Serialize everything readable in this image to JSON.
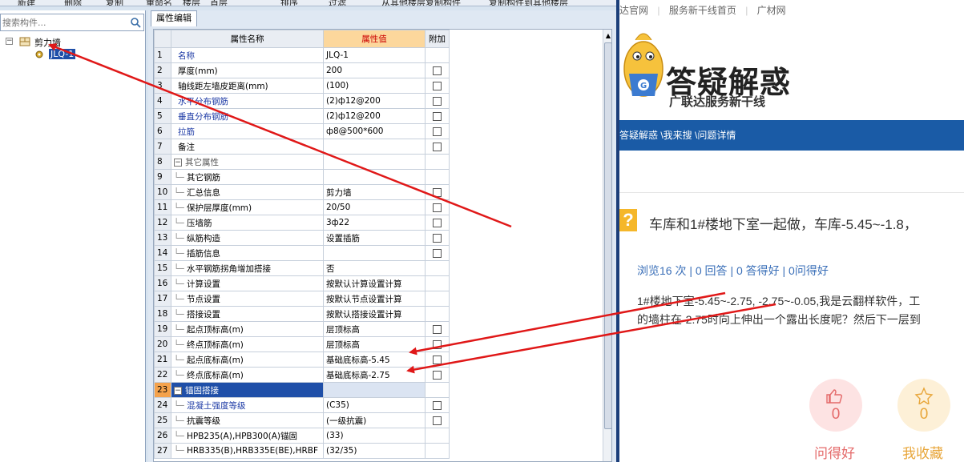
{
  "toolbar": {
    "items": [
      "新建",
      "删除",
      "复制",
      "重命名",
      "楼层",
      "首层",
      "排序",
      "过滤",
      "从其他楼层复制构件",
      "复制构件到其他楼层"
    ]
  },
  "tree": {
    "search_placeholder": "搜索构件...",
    "root": "剪力墙",
    "child": "JLQ-1"
  },
  "property_panel": {
    "tab": "属性编辑",
    "headers": {
      "name": "属性名称",
      "value": "属性值",
      "extra": "附加"
    },
    "rows": [
      {
        "num": "1",
        "name": "名称",
        "value": "JLQ-1",
        "check": false
      },
      {
        "num": "2",
        "name": "厚度(mm)",
        "value": "200",
        "check": true
      },
      {
        "num": "3",
        "name": "轴线距左墙皮距离(mm)",
        "value": "(100)",
        "check": true
      },
      {
        "num": "4",
        "name": "水平分布钢筋",
        "value": "(2)ф12@200",
        "check": true
      },
      {
        "num": "5",
        "name": "垂直分布钢筋",
        "value": "(2)ф12@200",
        "check": true
      },
      {
        "num": "6",
        "name": "拉筋",
        "value": "ф8@500*600",
        "check": true
      },
      {
        "num": "7",
        "name": "备注",
        "value": "",
        "check": true
      },
      {
        "num": "8",
        "name": "其它属性",
        "value": "",
        "check": false
      },
      {
        "num": "9",
        "name": "其它钢筋",
        "value": "",
        "check": false
      },
      {
        "num": "10",
        "name": "汇总信息",
        "value": "剪力墙",
        "check": true
      },
      {
        "num": "11",
        "name": "保护层厚度(mm)",
        "value": "20/50",
        "check": true
      },
      {
        "num": "12",
        "name": "压墙筋",
        "value": "3ф22",
        "check": true
      },
      {
        "num": "13",
        "name": "纵筋构造",
        "value": "设置插筋",
        "check": true
      },
      {
        "num": "14",
        "name": "插筋信息",
        "value": "",
        "check": true
      },
      {
        "num": "15",
        "name": "水平钢筋拐角增加搭接",
        "value": "否",
        "check": false
      },
      {
        "num": "16",
        "name": "计算设置",
        "value": "按默认计算设置计算",
        "check": false
      },
      {
        "num": "17",
        "name": "节点设置",
        "value": "按默认节点设置计算",
        "check": false
      },
      {
        "num": "18",
        "name": "搭接设置",
        "value": "按默认搭接设置计算",
        "check": false
      },
      {
        "num": "19",
        "name": "起点顶标高(m)",
        "value": "层顶标高",
        "check": true
      },
      {
        "num": "20",
        "name": "终点顶标高(m)",
        "value": "层顶标高",
        "check": true
      },
      {
        "num": "21",
        "name": "起点底标高(m)",
        "value": "基础底标高-5.45",
        "check": true
      },
      {
        "num": "22",
        "name": "终点底标高(m)",
        "value": "基础底标高-2.75",
        "check": true
      },
      {
        "num": "23",
        "name": "锚固搭接",
        "value": "",
        "check": false
      },
      {
        "num": "24",
        "name": "混凝土强度等级",
        "value": "(C35)",
        "check": true
      },
      {
        "num": "25",
        "name": "抗震等级",
        "value": "(一级抗震)",
        "check": true
      },
      {
        "num": "26",
        "name": "HPB235(A),HPB300(A)锚固",
        "value": "(33)",
        "check": false
      },
      {
        "num": "27",
        "name": "HRB335(B),HRB335E(BE),HRBF",
        "value": "(32/35)",
        "check": false
      }
    ]
  },
  "web": {
    "nav": [
      "达官网",
      "|",
      "服务新干线首页",
      "|",
      "广材网"
    ],
    "banner_title": "答疑解惑",
    "banner_subtitle": "广联达服务新干线",
    "breadcrumb": "答疑解惑 \\我来搜 \\问题详情",
    "question_icon": "?",
    "question_title": "车库和1#楼地下室一起做，车库-5.45~-1.8，",
    "stats": "浏览16 次 | 0 回答 | 0 答得好 | 0问得好",
    "body_line1": "1#楼地下室-5.45~-2.75, -2.75~-0.05,我是云翻样软件，工",
    "body_line2": "的墙柱在-2.75时向上伸出一个露出长度呢？然后下一层到",
    "like_count": "0",
    "like_label": "问得好",
    "fav_count": "0",
    "fav_label": "我收藏"
  }
}
